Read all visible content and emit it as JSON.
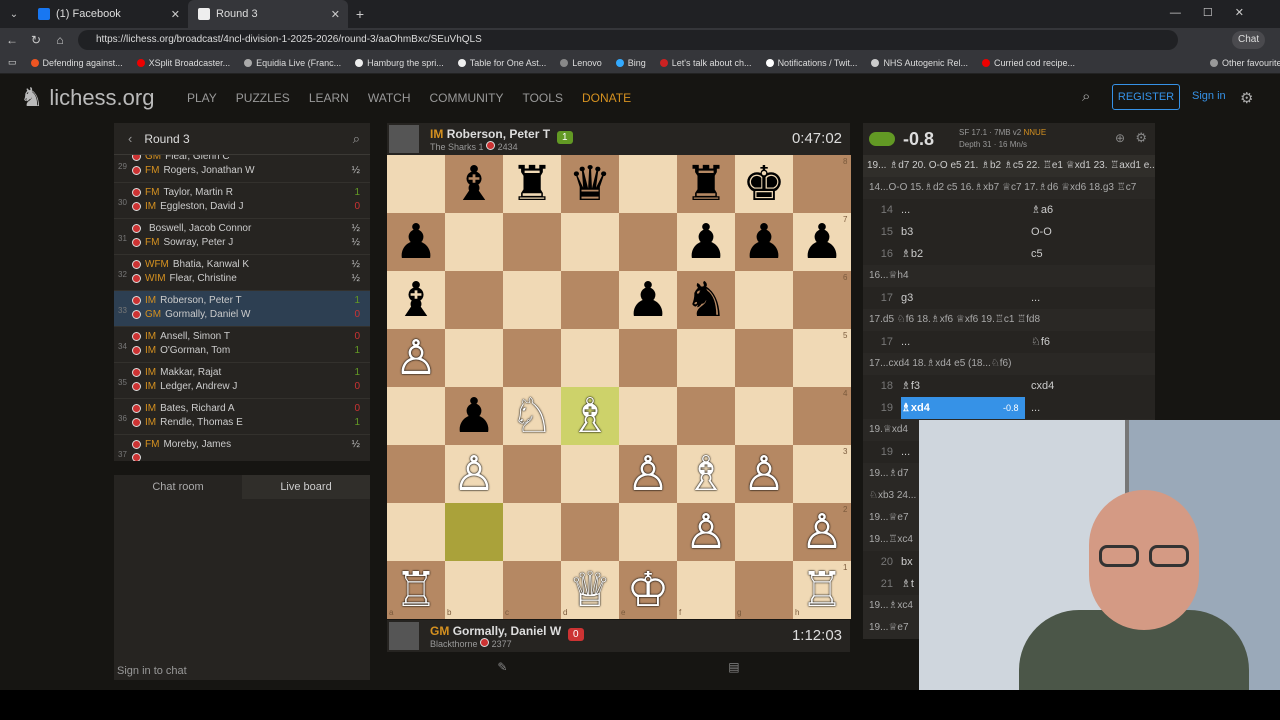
{
  "browser": {
    "tabs": [
      {
        "title": "(1) Facebook"
      },
      {
        "title": "Round 3"
      }
    ],
    "url": "https://lichess.org/broadcast/4ncl-division-1-2025-2026/round-3/aaOhmBxc/SEuVhQLS",
    "bookmarks": [
      "Defending against...",
      "XSplit Broadcaster...",
      "Equidia Live (Franc...",
      "Hamburg  the spri...",
      "Table for One  Ast...",
      "Lenovo",
      "Bing",
      "Let's talk about ch...",
      "Notifications / Twit...",
      "NHS Autogenic Rel...",
      "Curried cod recipe..."
    ],
    "other_favourites": "Other favourites",
    "chat_label": "Chat"
  },
  "site": {
    "logo": "lichess.org",
    "nav": [
      "PLAY",
      "PUZZLES",
      "LEARN",
      "WATCH",
      "COMMUNITY",
      "TOOLS",
      "DONATE"
    ],
    "register": "REGISTER",
    "signin": "Sign in"
  },
  "round": {
    "title": "Round 3",
    "pairings": [
      {
        "num": "29",
        "p1": {
          "title": "GM",
          "name": "Flear, Glenn C"
        },
        "p2": {
          "title": "FM",
          "name": "Rogers, Jonathan W"
        },
        "s1": "",
        "s2": "½"
      },
      {
        "num": "30",
        "p1": {
          "title": "FM",
          "name": "Taylor, Martin R"
        },
        "p2": {
          "title": "IM",
          "name": "Eggleston, David J"
        },
        "s1": "1",
        "s2": "0"
      },
      {
        "num": "31",
        "p1": {
          "title": "",
          "name": "Boswell, Jacob Connor"
        },
        "p2": {
          "title": "FM",
          "name": "Sowray, Peter J"
        },
        "s1": "½",
        "s2": "½"
      },
      {
        "num": "32",
        "p1": {
          "title": "WFM",
          "name": "Bhatia, Kanwal K"
        },
        "p2": {
          "title": "WIM",
          "name": "Flear, Christine"
        },
        "s1": "½",
        "s2": "½"
      },
      {
        "num": "33",
        "p1": {
          "title": "IM",
          "name": "Roberson, Peter T"
        },
        "p2": {
          "title": "GM",
          "name": "Gormally, Daniel W"
        },
        "s1": "1",
        "s2": "0"
      },
      {
        "num": "34",
        "p1": {
          "title": "IM",
          "name": "Ansell, Simon T"
        },
        "p2": {
          "title": "IM",
          "name": "O'Gorman, Tom"
        },
        "s1": "0",
        "s2": "1"
      },
      {
        "num": "35",
        "p1": {
          "title": "IM",
          "name": "Makkar, Rajat"
        },
        "p2": {
          "title": "IM",
          "name": "Ledger, Andrew J"
        },
        "s1": "1",
        "s2": "0"
      },
      {
        "num": "36",
        "p1": {
          "title": "IM",
          "name": "Bates, Richard A"
        },
        "p2": {
          "title": "IM",
          "name": "Rendle, Thomas E"
        },
        "s1": "0",
        "s2": "1"
      },
      {
        "num": "37",
        "p1": {
          "title": "FM",
          "name": "Moreby, James"
        },
        "p2": {
          "title": "",
          "name": ""
        },
        "s1": "½",
        "s2": ""
      }
    ],
    "selected": 4
  },
  "chat": {
    "tab1": "Chat room",
    "tab2": "Live board",
    "signin": "Sign in to chat"
  },
  "top_player": {
    "title": "IM",
    "name": "Roberson, Peter T",
    "team": "The Sharks 1",
    "rating": "2434",
    "score": "1",
    "clock": "0:47:02"
  },
  "bottom_player": {
    "title": "GM",
    "name": "Gormally, Daniel W",
    "team": "Blackthorne",
    "rating": "2377",
    "score": "0",
    "clock": "1:12:03"
  },
  "board": {
    "ranks": [
      [
        "",
        "♝",
        "♜",
        "♛",
        "",
        "♜",
        "♚",
        ""
      ],
      [
        "♟",
        "",
        "",
        "",
        "",
        "♟",
        "♟",
        "♟"
      ],
      [
        "♝",
        "",
        "",
        "",
        "♟",
        "♞",
        "",
        ""
      ],
      [
        "♙",
        "",
        "",
        "",
        "",
        "",
        "",
        ""
      ],
      [
        "",
        "♟",
        "♘",
        "♗",
        "",
        "",
        "",
        ""
      ],
      [
        "",
        "♙",
        "",
        "",
        "♙",
        "♗",
        "♙",
        ""
      ],
      [
        "",
        "",
        "",
        "",
        "",
        "♙",
        "",
        "♙"
      ],
      [
        "♖",
        "",
        "",
        "♕",
        "♔",
        "",
        "",
        "♖"
      ]
    ],
    "files": [
      "a",
      "b",
      "c",
      "d",
      "e",
      "f",
      "g",
      "h"
    ],
    "rank_labels": [
      "8",
      "7",
      "6",
      "5",
      "4",
      "3",
      "2",
      "1"
    ]
  },
  "engine": {
    "eval": "-0.8",
    "name": "SF 17.1 · 7MB v2",
    "nnue": "NNUE",
    "depth": "Depth 31 · 16 Mn/s",
    "pv": "19... ♗d7 20. O-O e5 21. ♗b2 ♗c5 22. ♖e1 ♕xd1 23. ♖axd1 e..."
  },
  "moves": {
    "rows": [
      {
        "type": "var",
        "text": "14...O-O 15.♗d2 c5 16.♗xb7 ♕c7 17.♗d6 ♕xd6 18.g3 ♖c7"
      },
      {
        "type": "move",
        "n": "14",
        "w": "...",
        "b": "♗a6"
      },
      {
        "type": "move",
        "n": "15",
        "w": "b3",
        "b": "O-O"
      },
      {
        "type": "move",
        "n": "16",
        "w": "♗b2",
        "b": "c5"
      },
      {
        "type": "var",
        "text": "16...♕h4"
      },
      {
        "type": "move",
        "n": "17",
        "w": "g3",
        "b": "..."
      },
      {
        "type": "var",
        "text": "17.d5 ♘f6 18.♗xf6 ♕xf6 19.♖c1 ♖fd8"
      },
      {
        "type": "move",
        "n": "17",
        "w": "...",
        "b": "♘f6"
      },
      {
        "type": "var",
        "text": "17...cxd4 18.♗xd4 e5 (18...♘f6)"
      },
      {
        "type": "move",
        "n": "18",
        "w": "♗f3",
        "b": "cxd4"
      },
      {
        "type": "move",
        "n": "19",
        "w": "♗xd4",
        "b": "...",
        "eval": "-0.8"
      },
      {
        "type": "var",
        "text": "19.♕xd4"
      },
      {
        "type": "move",
        "n": "19",
        "w": "...",
        "b": ""
      },
      {
        "type": "var",
        "text": "19...♗d7"
      },
      {
        "type": "var",
        "text": "♘xb3 24..."
      },
      {
        "type": "var",
        "text": "19...♕e7"
      },
      {
        "type": "var",
        "text": "19...♖xc4"
      },
      {
        "type": "move",
        "n": "20",
        "w": "bx",
        "b": ""
      },
      {
        "type": "move",
        "n": "21",
        "w": "♗t",
        "b": ""
      },
      {
        "type": "var",
        "text": "19...♗xc4"
      },
      {
        "type": "var",
        "text": "19...♕e7"
      }
    ]
  }
}
